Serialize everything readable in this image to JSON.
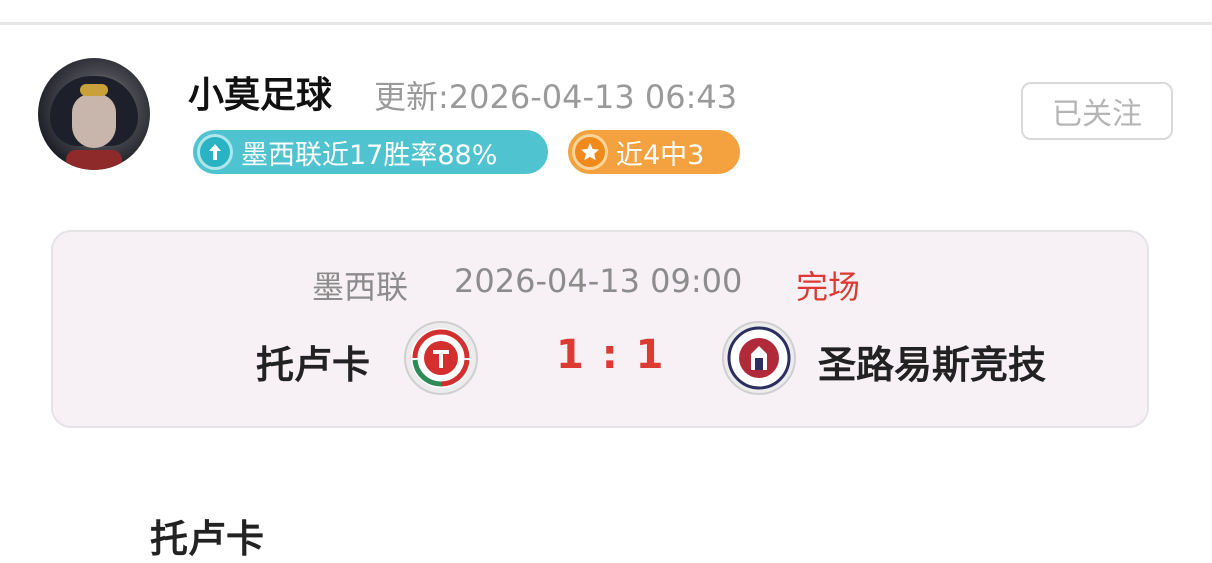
{
  "author": {
    "name": "小莫足球",
    "update_time": "更新:2026-04-13 06:43",
    "follow_label": "已关注"
  },
  "badges": [
    {
      "text": "墨西联近17胜率88%",
      "icon": "arrow-up-icon",
      "color": "#4fc3cf"
    },
    {
      "text": "近4中3",
      "icon": "star-icon",
      "color": "#f3a23f"
    }
  ],
  "match": {
    "league": "墨西联",
    "kickoff": "2026-04-13 09:00",
    "status": "完场",
    "home_team": "托卢卡",
    "away_team": "圣路易斯竞技",
    "score": "1 : 1",
    "home_logo_icon": "toluca-crest-icon",
    "away_logo_icon": "atletico-san-luis-crest-icon"
  },
  "next_section_title": "托卢卡",
  "colors": {
    "accent_red": "#dc3b33",
    "badge_teal": "#4fc3cf",
    "badge_orange": "#f3a23f"
  }
}
